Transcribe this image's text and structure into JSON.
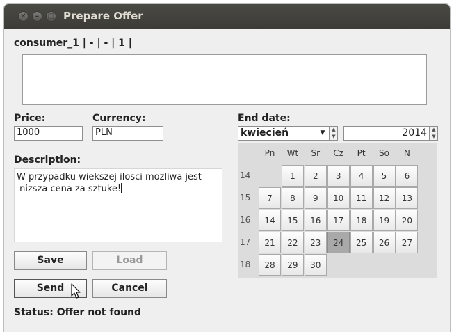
{
  "window": {
    "title": "Prepare Offer"
  },
  "header": {
    "consumer_info": "consumer_1 | - | - | 1 |"
  },
  "price": {
    "label": "Price:",
    "value": "1000"
  },
  "currency": {
    "label": "Currency:",
    "value": "PLN"
  },
  "description": {
    "label": "Description:",
    "text": "W przypadku wiekszej ilosci mozliwa jest\n nizsza cena za sztuke!"
  },
  "end_date": {
    "label": "End date:",
    "month": "kwiecień",
    "year": "2014",
    "weekday_headers": [
      "Pn",
      "Wt",
      "Śr",
      "Cz",
      "Pt",
      "So",
      "N"
    ],
    "weeks": [
      {
        "num": "14",
        "days": [
          "",
          "1",
          "2",
          "3",
          "4",
          "5",
          "6"
        ]
      },
      {
        "num": "15",
        "days": [
          "7",
          "8",
          "9",
          "10",
          "11",
          "12",
          "13"
        ]
      },
      {
        "num": "16",
        "days": [
          "14",
          "15",
          "16",
          "17",
          "18",
          "19",
          "20"
        ]
      },
      {
        "num": "17",
        "days": [
          "21",
          "22",
          "23",
          "24",
          "25",
          "26",
          "27"
        ]
      },
      {
        "num": "18",
        "days": [
          "28",
          "29",
          "30",
          "",
          "",
          "",
          ""
        ]
      }
    ],
    "selected_day": "24"
  },
  "buttons": {
    "save": "Save",
    "load": "Load",
    "send": "Send",
    "cancel": "Cancel"
  },
  "status": {
    "text": "Status: Offer not found"
  }
}
